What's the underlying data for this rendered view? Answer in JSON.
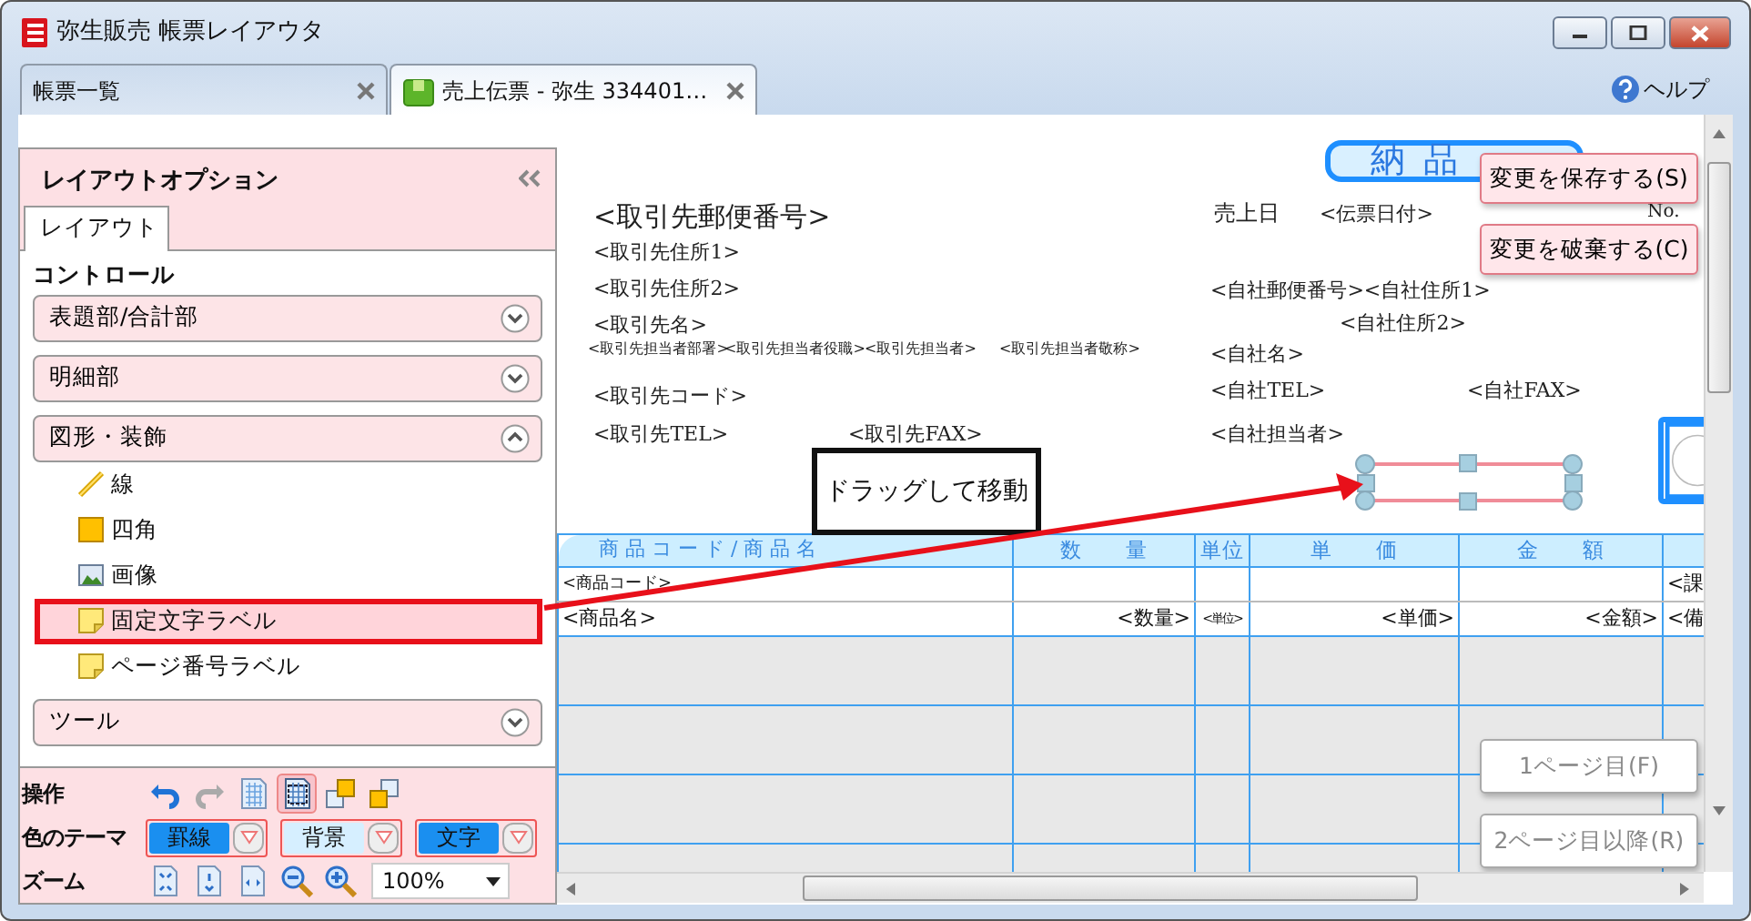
{
  "window": {
    "title": "弥生販売 帳票レイアウタ"
  },
  "tabs": [
    {
      "label": "帳票一覧",
      "selected": false
    },
    {
      "label": "売上伝票 - 弥生 334401…",
      "selected": true
    }
  ],
  "help": {
    "label": "ヘルプ"
  },
  "layout_panel": {
    "title": "レイアウトオプション",
    "tabs": [
      {
        "label": "レイアウト",
        "selected": true
      }
    ],
    "section_title": "コントロール",
    "groups": [
      {
        "label": "表題部/合計部",
        "expanded": false
      },
      {
        "label": "明細部",
        "expanded": false
      },
      {
        "label": "図形・装飾",
        "expanded": true,
        "items": [
          {
            "label": "線",
            "kind": "line",
            "highlighted": false
          },
          {
            "label": "四角",
            "kind": "rect",
            "highlighted": false
          },
          {
            "label": "画像",
            "kind": "image",
            "highlighted": false
          },
          {
            "label": "固定文字ラベル",
            "kind": "label",
            "highlighted": true
          },
          {
            "label": "ページ番号ラベル",
            "kind": "label",
            "highlighted": false
          }
        ]
      },
      {
        "label": "ツール",
        "expanded": false
      }
    ]
  },
  "operations": {
    "label": "操作",
    "tools": [
      {
        "kind": "undo",
        "selected": false
      },
      {
        "kind": "redo",
        "selected": false
      },
      {
        "kind": "grid",
        "selected": false
      },
      {
        "kind": "grid-frame",
        "selected": true
      },
      {
        "kind": "front",
        "selected": false
      },
      {
        "kind": "back",
        "selected": false
      }
    ]
  },
  "theme": {
    "label": "色のテーマ",
    "options": [
      {
        "label": "罫線",
        "on": true
      },
      {
        "label": "背景",
        "on": false
      },
      {
        "label": "文字",
        "on": true
      }
    ]
  },
  "zoom": {
    "label": "ズーム",
    "value": "100%"
  },
  "document": {
    "title": "納 品",
    "fields": [
      "<取引先郵便番号>",
      "<取引先住所1>",
      "<取引先住所2>",
      "<取引先名>",
      "<取引先担当者部署>",
      "<取引先担当者役職>",
      "<取引先担当者>",
      "<取引先担当者敬称>",
      "<取引先コード>",
      "<取引先TEL>",
      "<取引先FAX>",
      "売上日",
      "<伝票日付>",
      "No.",
      "<自社郵便番号><自社住所1>",
      "<自社住所2>",
      "<自社名>",
      "<自社TEL>",
      "<自社FAX>",
      "<自社担当者>"
    ],
    "table": {
      "columns": [
        "商 品 コ ー ド / 商 品 名",
        "数　　量",
        "単位",
        "単　　価",
        "金　　額"
      ],
      "rows": [
        {
          "product_code": "<商品コード>",
          "column_6": "<課"
        },
        {
          "product_name": "<商品名>",
          "quantity": "<数量>",
          "unit": "<単位>",
          "unit_price": "<単価>",
          "amount": "<金額>",
          "column_6": "<備"
        }
      ]
    }
  },
  "callout": {
    "text": "ドラッグして移動"
  },
  "actions": [
    {
      "label": "変更を保存する(S)",
      "kind": "edit"
    },
    {
      "label": "変更を破棄する(C)",
      "kind": "edit"
    },
    {
      "label": "1ページ目(F)",
      "kind": "page"
    },
    {
      "label": "2ページ目以降(R)",
      "kind": "page"
    }
  ]
}
